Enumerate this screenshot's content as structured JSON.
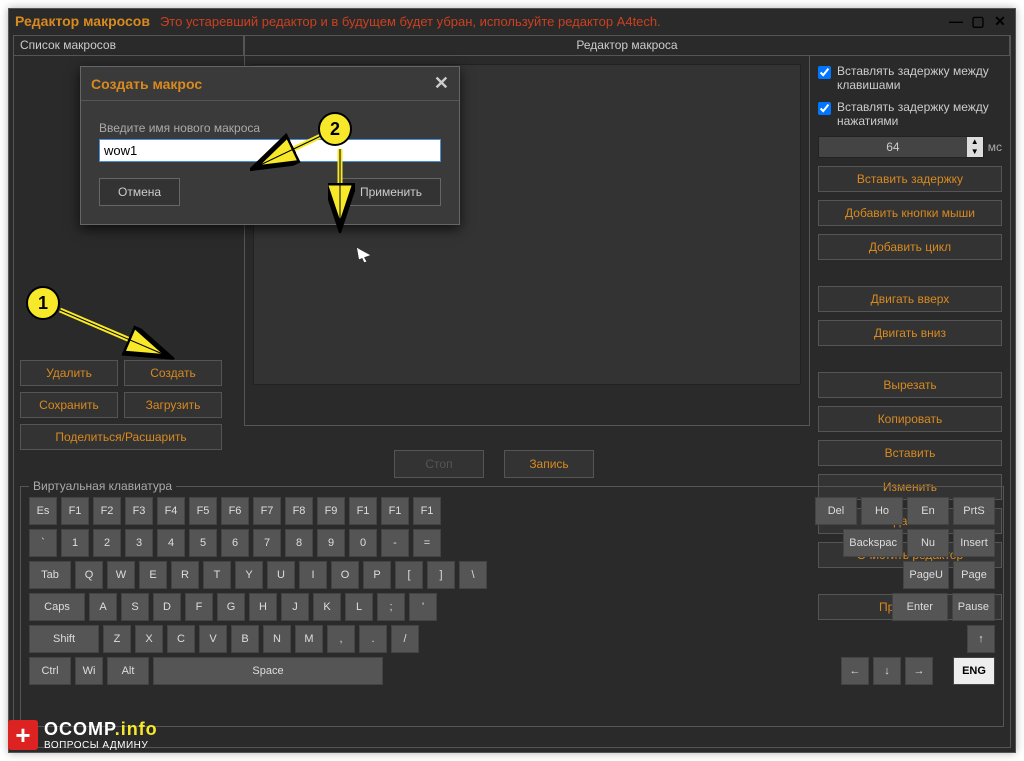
{
  "titlebar": {
    "title": "Редактор макросов",
    "warning": "Это устаревший редактор и в будущем будет убран, используйте редактор A4tech."
  },
  "columns": {
    "left": "Список макросов",
    "mid": "Редактор макроса"
  },
  "macroListButtons": {
    "delete": "Удалить",
    "create": "Создать",
    "save": "Сохранить",
    "load": "Загрузить",
    "share": "Поделиться/Расшарить"
  },
  "midButtons": {
    "stop": "Стоп",
    "record": "Запись"
  },
  "rightPanel": {
    "cbKeys": "Вставлять задержку между клавишами",
    "cbPress": "Вставлять задержку между нажатиями",
    "delayValue": "64",
    "ms": "мс",
    "insertDelay": "Вставить задержку",
    "addMouse": "Добавить кнопки мыши",
    "addLoop": "Добавить цикл",
    "moveUp": "Двигать вверх",
    "moveDown": "Двигать вниз",
    "cut": "Вырезать",
    "copy": "Копировать",
    "paste": "Вставить",
    "edit": "Изменить",
    "delete": "Удалить",
    "clear": "Очистить редактор",
    "apply": "Применить"
  },
  "vk": {
    "legend": "Виртуальная клавиатура",
    "row1": [
      "Es",
      "F1",
      "F2",
      "F3",
      "F4",
      "F5",
      "F6",
      "F7",
      "F8",
      "F9",
      "F1",
      "F1",
      "F1",
      "Del",
      "Ho",
      "En",
      "PrtS"
    ],
    "row2": [
      "`",
      "1",
      "2",
      "3",
      "4",
      "5",
      "6",
      "7",
      "8",
      "9",
      "0",
      "-",
      "=",
      "Backspac",
      "Nu",
      "Insert"
    ],
    "row3": [
      "Tab",
      "Q",
      "W",
      "E",
      "R",
      "T",
      "Y",
      "U",
      "I",
      "O",
      "P",
      "[",
      "]",
      "\\",
      "PageU",
      "Page"
    ],
    "row4": [
      "Caps",
      "A",
      "S",
      "D",
      "F",
      "G",
      "H",
      "J",
      "K",
      "L",
      ";",
      "'",
      "Enter",
      "Pause"
    ],
    "row5": [
      "Shift",
      "Z",
      "X",
      "C",
      "V",
      "B",
      "N",
      "M",
      ",",
      ".",
      "/",
      "↑"
    ],
    "row6": [
      "Ctrl",
      "Wi",
      "Alt",
      "Space",
      "←",
      "↓",
      "→",
      "ENG"
    ]
  },
  "modal": {
    "title": "Создать макрос",
    "label": "Введите имя нового макроса",
    "value": "wow1",
    "cancel": "Отмена",
    "apply": "Применить"
  },
  "annotations": {
    "b1": "1",
    "b2": "2"
  },
  "watermark": {
    "brand": "OCOMP",
    "suffix": ".info",
    "sub": "ВОПРОСЫ АДМИНУ"
  }
}
